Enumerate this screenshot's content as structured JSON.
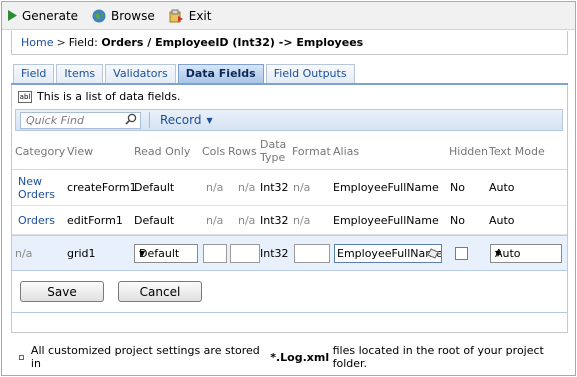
{
  "toolbar": {
    "generate": "Generate",
    "browse": "Browse",
    "exit": "Exit"
  },
  "breadcrumb": {
    "home": "Home",
    "separator": ">",
    "prefix": "Field:",
    "title": "Orders / EmployeeID (Int32) -> Employees"
  },
  "tabs": [
    {
      "label": "Field",
      "active": false
    },
    {
      "label": "Items",
      "active": false
    },
    {
      "label": "Validators",
      "active": false
    },
    {
      "label": "Data Fields",
      "active": true
    },
    {
      "label": "Field Outputs",
      "active": false
    }
  ],
  "description": "This is a list of data fields.",
  "description_icon": "abl",
  "quick_find": {
    "placeholder": "Quick Find"
  },
  "record_menu": "Record",
  "columns": {
    "category": "Category",
    "view": "View",
    "read_only": "Read Only",
    "cols": "Cols",
    "rows": "Rows",
    "data_type": "Data Type",
    "format": "Format",
    "alias": "Alias",
    "hidden": "Hidden",
    "text_mode": "Text Mode"
  },
  "rows": [
    {
      "category": "New Orders",
      "view": "createForm1",
      "read_only": "Default",
      "cols": "n/a",
      "rows": "n/a",
      "data_type": "Int32",
      "format": "n/a",
      "alias": "EmployeeFullName",
      "hidden": "No",
      "text_mode": "Auto"
    },
    {
      "category": "Orders",
      "view": "editForm1",
      "read_only": "Default",
      "cols": "n/a",
      "rows": "n/a",
      "data_type": "Int32",
      "format": "n/a",
      "alias": "EmployeeFullName",
      "hidden": "No",
      "text_mode": "Auto"
    }
  ],
  "edit_row": {
    "category": "n/a",
    "view": "grid1",
    "read_only": "Default",
    "cols": "",
    "rows": "",
    "data_type": "Int32",
    "format": "",
    "alias": "EmployeeFullName",
    "hidden": false,
    "text_mode": "Auto"
  },
  "buttons": {
    "save": "Save",
    "cancel": "Cancel"
  },
  "footer": {
    "before": "All customized project settings are stored in",
    "file": "*.Log.xml",
    "after": "files located in the root of your project folder."
  },
  "colors": {
    "accent": "#1b4f9c",
    "tab_active": "#a9c5e8",
    "selected_row": "#e8f0fb"
  }
}
